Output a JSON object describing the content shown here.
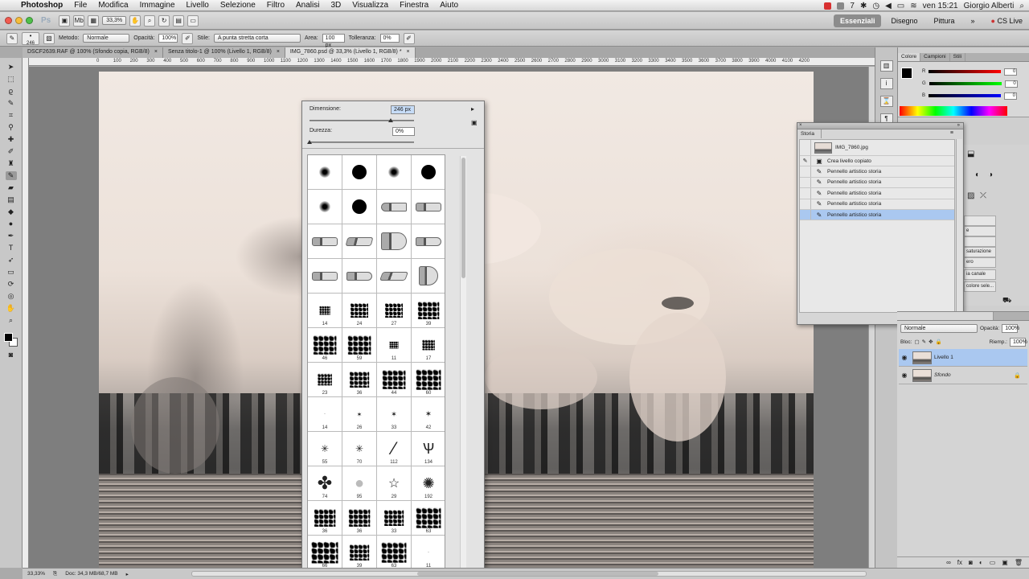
{
  "menubar": {
    "apple": "",
    "app": "Photoshop",
    "items": [
      "File",
      "Modifica",
      "Immagine",
      "Livello",
      "Selezione",
      "Filtro",
      "Analisi",
      "3D",
      "Visualizza",
      "Finestra",
      "Aiuto"
    ],
    "clock": "ven 15:21",
    "user": "Giorgio Alberti",
    "battery_num": "7"
  },
  "appbar": {
    "logo": "Ps",
    "zoom": "33,3%",
    "workspaces": [
      "Essenziali",
      "Disegno",
      "Pittura"
    ],
    "more": "»",
    "cs_live": "CS Live"
  },
  "options": {
    "brush_size": "246",
    "metodo_label": "Metodo:",
    "metodo_value": "Normale",
    "opacita_label": "Opacità:",
    "opacita_value": "100%",
    "stile_label": "Stile:",
    "stile_value": "A punta stretta corta",
    "area_label": "Area:",
    "area_value": "100 px",
    "tolleranza_label": "Tolleranza:",
    "tolleranza_value": "0%"
  },
  "tabs": [
    {
      "label": "DSCF2639.RAF @ 100% (Sfondo copia, RGB/8)",
      "close": "×"
    },
    {
      "label": "Senza titolo-1 @ 100% (Livello 1, RGB/8)",
      "close": "×"
    },
    {
      "label": "IMG_7860.psd @ 33,3% (Livello 1, RGB/8) *",
      "close": "×"
    }
  ],
  "ruler_ticks": [
    "0",
    "100",
    "200",
    "300",
    "400",
    "500",
    "600",
    "700",
    "800",
    "900",
    "1000",
    "1100",
    "1200",
    "1300",
    "1400",
    "1500",
    "1600",
    "1700",
    "1800",
    "1900",
    "2000",
    "2100",
    "2200",
    "2300",
    "2400",
    "2500",
    "2600",
    "2700",
    "2800",
    "2900",
    "3000",
    "3100",
    "3200",
    "3300",
    "3400",
    "3500",
    "3600",
    "3700",
    "3800",
    "3900",
    "4000",
    "4100",
    "4200"
  ],
  "brush_picker": {
    "dimensione_label": "Dimensione:",
    "dimensione_value": "246 px",
    "durezza_label": "Durezza:",
    "durezza_value": "0%",
    "dimensione_level": 0.78,
    "durezza_level": 0.0,
    "brush_numbers": {
      "r5": [
        "14",
        "24",
        "27",
        "39"
      ],
      "r6": [
        "46",
        "59",
        "11",
        "17"
      ],
      "r7": [
        "23",
        "36",
        "44",
        "60"
      ],
      "r8": [
        "14",
        "26",
        "33",
        "42"
      ],
      "r9": [
        "55",
        "70",
        "112",
        "134"
      ],
      "r10": [
        "74",
        "95",
        "29",
        "192"
      ],
      "r11": [
        "36",
        "36",
        "33",
        "63"
      ],
      "r12": [
        "66",
        "39",
        "63",
        "11"
      ]
    }
  },
  "color_panel": {
    "tabs": [
      "Colore",
      "Campioni",
      "Stili"
    ],
    "r_label": "R",
    "r_value": "0",
    "g_label": "G",
    "g_value": "0",
    "b_label": "B",
    "b_value": "0"
  },
  "history": {
    "tab": "Storia",
    "snapshot": "IMG_7860.jpg",
    "steps": [
      "Crea livello copiato",
      "Pennello artistico storia",
      "Pennello artistico storia",
      "Pennello artistico storia",
      "Pennello artistico storia",
      "Pennello artistico storia"
    ]
  },
  "mid_panel_rows": [
    "e",
    "saturazione",
    "ero",
    "ia canale",
    "colore sele..."
  ],
  "layers": {
    "blend": "Normale",
    "opacity_label": "Opacità:",
    "opacity_value": "100%",
    "lock_label": "Bloc:",
    "fill_label": "Riemp.:",
    "fill_value": "100%",
    "items": [
      {
        "name": "Livello 1",
        "selected": true
      },
      {
        "name": "Sfondo",
        "selected": false
      }
    ]
  },
  "status": {
    "zoom": "33,33%",
    "doc": "Doc: 34,3 MB/68,7 MB"
  },
  "colors": {
    "accent_selected": "#aac8f0",
    "menubar_red": "#d83030"
  }
}
